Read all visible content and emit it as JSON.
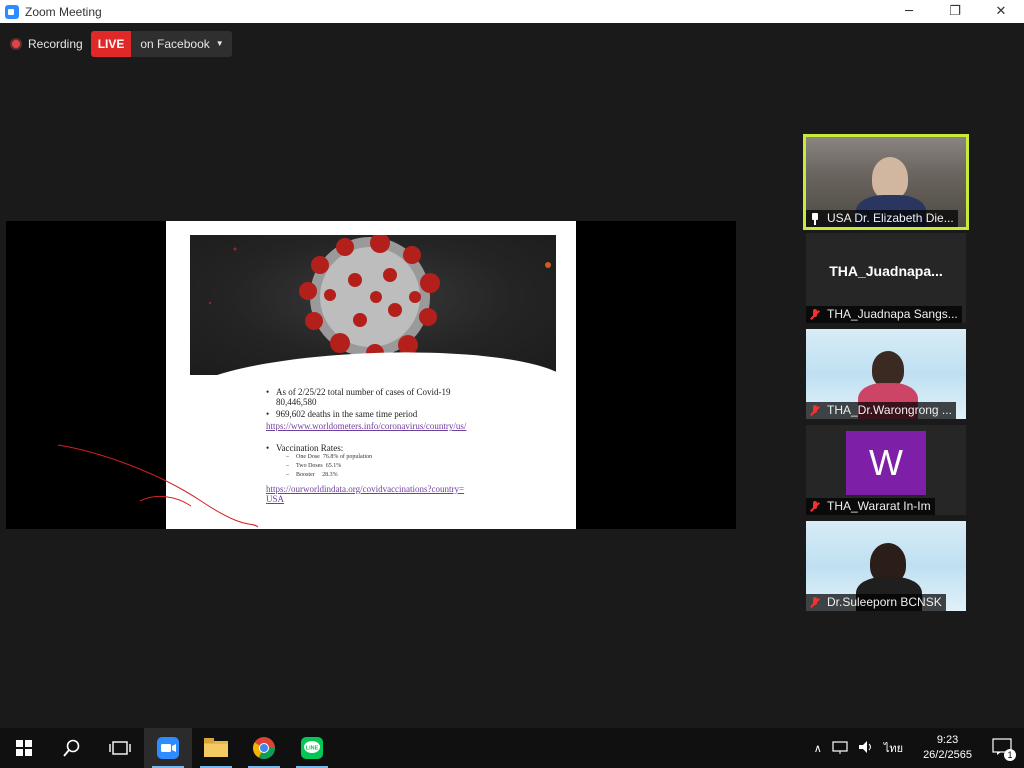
{
  "window": {
    "title": "Zoom Meeting",
    "minimize": "─",
    "restore": "❐",
    "close": "✕"
  },
  "recording": {
    "label": "Recording",
    "live_badge": "LIVE",
    "live_target": "on Facebook"
  },
  "slide": {
    "bullets": [
      {
        "text": "As of 2/25/22 total number of cases of Covid-19",
        "sub": "80,446,580"
      },
      {
        "text": "969,602 deaths in the same time period"
      }
    ],
    "link1": "https://www.worldometers.info/coronavirus/country/us/",
    "vacc_heading": "Vaccination Rates:",
    "vacc_items": [
      {
        "label": "One Dose",
        "value": "76.8% of population"
      },
      {
        "label": "Two Doses",
        "value": "65.1%"
      },
      {
        "label": "Booster",
        "value": "28.3%"
      }
    ],
    "link2_line1": "https://ourworldindata.org/covidvaccinations?country=",
    "link2_line2": "USA"
  },
  "participants": [
    {
      "name": "USA Dr. Elizabeth Die...",
      "pinned": true,
      "muted": false,
      "active_speaker": true,
      "video": "home"
    },
    {
      "name": "THA_Juadnapa Sangs...",
      "display_name": "THA_Juadnapa...",
      "muted": true,
      "video": "none"
    },
    {
      "name": "THA_Dr.Warongrong ...",
      "muted": true,
      "video": "conference"
    },
    {
      "name": "THA_Wararat In-Im",
      "avatar_letter": "W",
      "avatar_color": "#7e1fa8",
      "muted": true,
      "video": "avatar"
    },
    {
      "name": "Dr.Suleeporn BCNSK",
      "muted": true,
      "video": "conference"
    }
  ],
  "taskbar": {
    "apps": [
      "start",
      "search",
      "task-view",
      "zoom",
      "file-explorer",
      "chrome",
      "line"
    ],
    "tray": {
      "chevron": "∧",
      "language": "ไทย",
      "time": "9:23",
      "date": "26/2/2565",
      "notifications": "1"
    }
  },
  "colors": {
    "live": "#e02828",
    "active_speaker": "#c8ea3a",
    "muted": "#e33333",
    "link": "#7040a0"
  }
}
